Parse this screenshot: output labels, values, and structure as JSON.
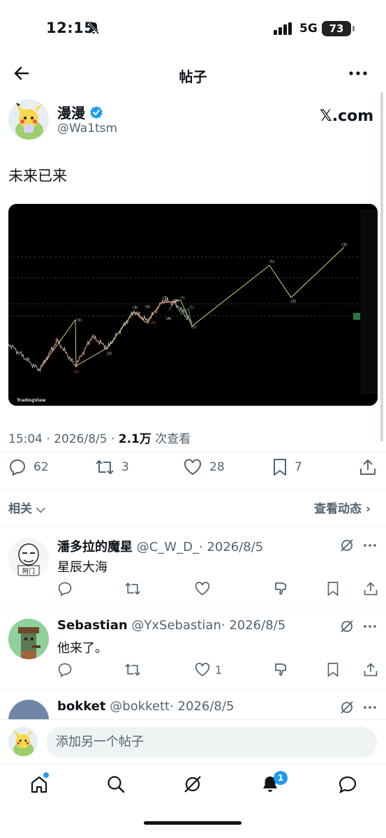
{
  "status_bar": {
    "time": "12:15",
    "network": "5G",
    "battery": "73"
  },
  "header": {
    "title": "帖子"
  },
  "post": {
    "author_name": "漫漫",
    "author_handle": "@Wa1tsm",
    "source": "𝕏.com",
    "text": "未来已来",
    "timestamp": "15:04 · 2026/8/5 · ",
    "views_count": "2.1万",
    "views_label": " 次查看",
    "replies": "62",
    "reposts": "3",
    "likes": "28",
    "bookmarks": "7",
    "chart_image": {
      "watermark": "TradingView",
      "wave_labels": [
        "(1)",
        "(2)",
        "(1)",
        "(2)",
        "(3)",
        "(4)",
        "(5)",
        "(3)",
        "(4)",
        "(5)",
        "(A)",
        "(B)",
        "(C)",
        "(1)",
        "(2)",
        "(3)",
        "(4)",
        "(5)"
      ]
    }
  },
  "related": {
    "label": "相关",
    "view_activity": "查看动态"
  },
  "replies": [
    {
      "name": "潘多拉的魔星",
      "handle": "@C_W_D_",
      "date": "· 2026/8/5",
      "text": "星辰大海",
      "likes": "",
      "avatar_caption": "阿门"
    },
    {
      "name": "Sebastian",
      "handle": "@YxSebastian",
      "date": "· 2026/8/5",
      "text": "他来了。",
      "likes": "1"
    },
    {
      "name": "bokket",
      "handle": "@bokkett",
      "date": "· 2026/8/5",
      "text": "",
      "likes": ""
    }
  ],
  "compose": {
    "placeholder": "添加另一个帖子"
  },
  "tabbar": {
    "notif_badge": "1"
  },
  "colors": {
    "accent": "#1d9bf0",
    "text": "#0f1419",
    "secondary": "#536471"
  }
}
